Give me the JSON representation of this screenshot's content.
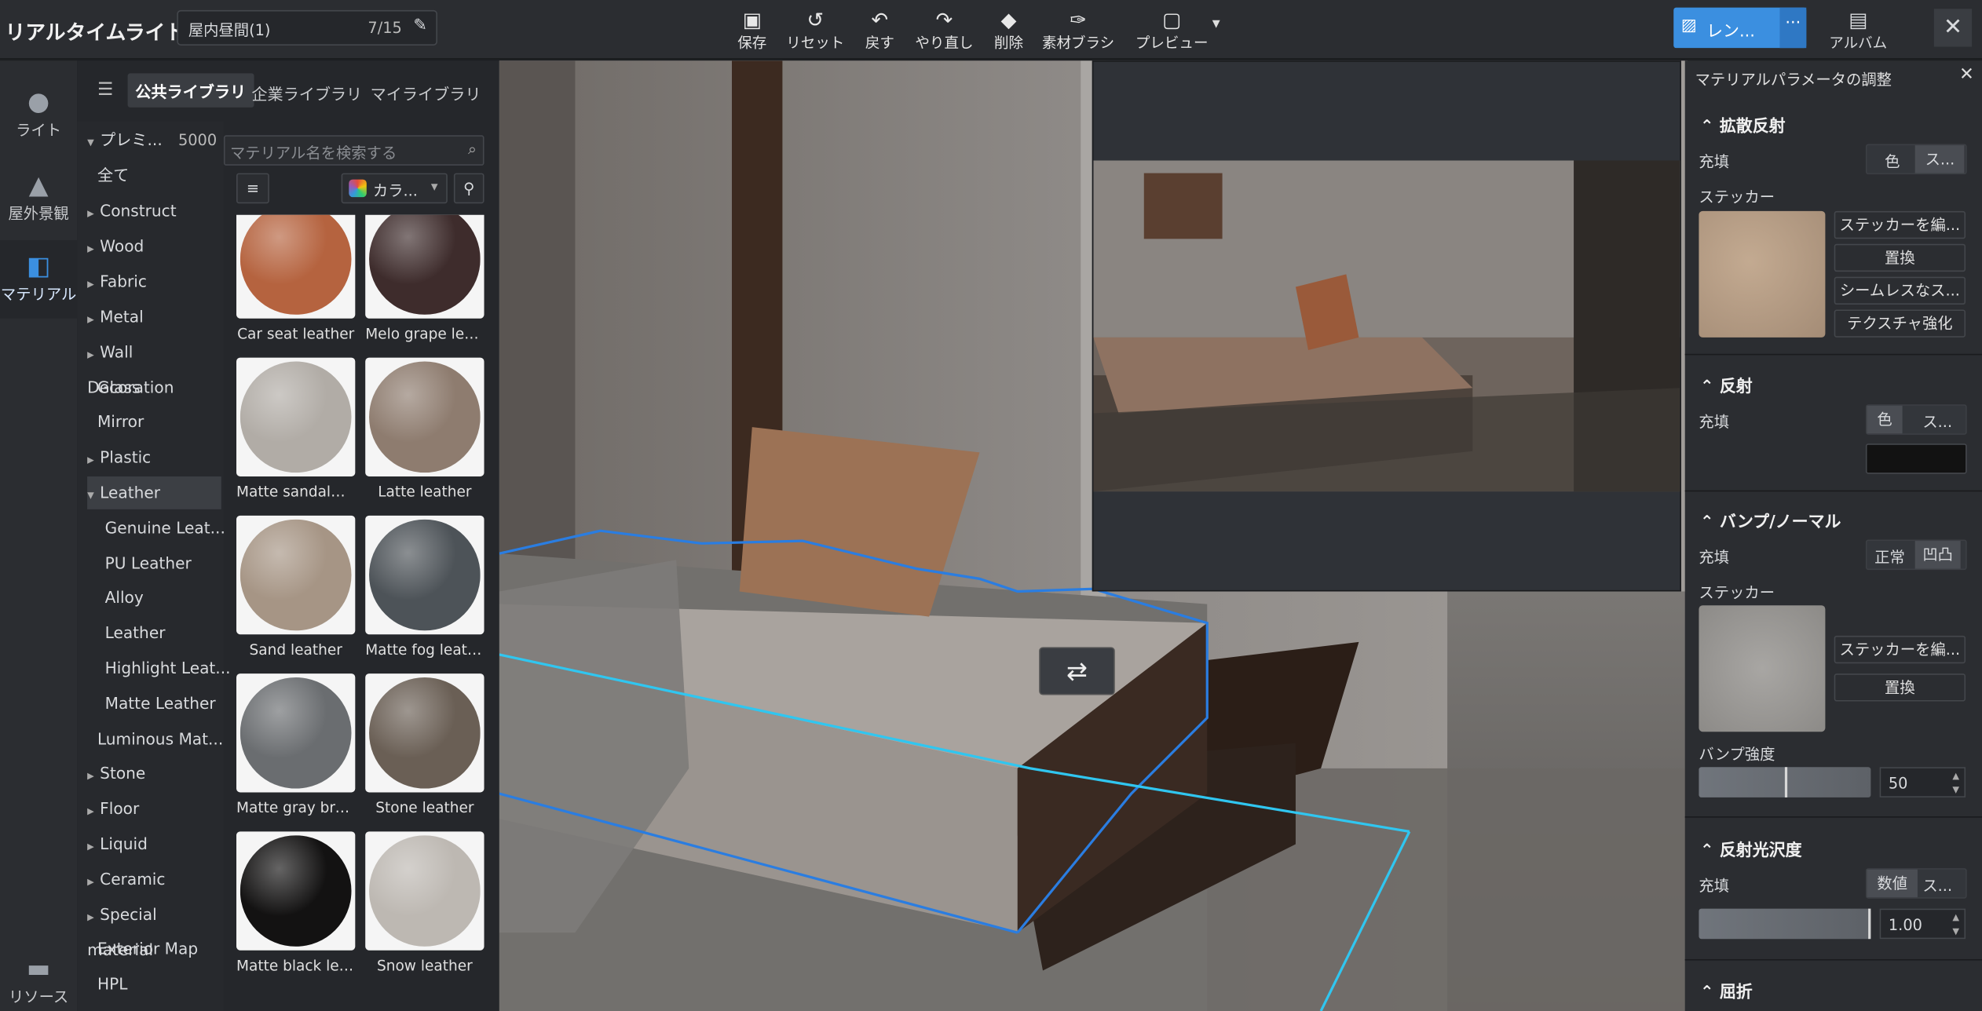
{
  "app": {
    "title": "リアルタイムライト",
    "scene_name": "屋内昼間(1)",
    "scene_count": "7/15"
  },
  "toolbar": [
    {
      "icon": "save-icon",
      "label": "保存"
    },
    {
      "icon": "reset-icon",
      "label": "リセット"
    },
    {
      "icon": "undo-icon",
      "label": "戻す"
    },
    {
      "icon": "redo-icon",
      "label": "やり直し"
    },
    {
      "icon": "eraser-icon",
      "label": "削除"
    },
    {
      "icon": "brush-icon",
      "label": "素材ブラシ"
    },
    {
      "icon": "preview-icon",
      "label": "プレビュー"
    }
  ],
  "render_button": {
    "label": "レン...",
    "more": "···"
  },
  "album": {
    "label": "アルバム"
  },
  "leftnav": [
    {
      "label": "ライト"
    },
    {
      "label": "屋外景観"
    },
    {
      "label": "マテリアル"
    },
    {
      "label": "リソース"
    }
  ],
  "library": {
    "tabs": [
      "公共ライブラリ",
      "企業ライブラリ",
      "マイライブラリ"
    ],
    "premium": {
      "label": "プレミ...",
      "count": "5000"
    },
    "categories": [
      "全て",
      "Construct",
      "Wood",
      "Fabric",
      "Metal",
      "Wall Decoration",
      "Glass",
      "Mirror",
      "Plastic",
      "Leather",
      "Genuine Leat...",
      "PU Leather",
      "Alloy",
      "Leather",
      "Highlight Leat...",
      "Matte Leather",
      "Luminous Mat...",
      "Stone",
      "Floor",
      "Liquid",
      "Ceramic",
      "Special material",
      "Exterior Map",
      "HPL"
    ],
    "search_placeholder": "マテリアル名を検索する",
    "color_filter": "カラ...",
    "materials": [
      {
        "name": "Car seat leather",
        "color": "#b5633f"
      },
      {
        "name": "Melo grape leather",
        "color": "#3e2c2c"
      },
      {
        "name": "Matte sandalwoo...",
        "color": "#b1aca6"
      },
      {
        "name": "Latte leather",
        "color": "#8e7c6f"
      },
      {
        "name": "Sand leather",
        "color": "#a69585"
      },
      {
        "name": "Matte fog leather",
        "color": "#4d5358"
      },
      {
        "name": "Matte gray brow...",
        "color": "#6a6d70"
      },
      {
        "name": "Stone leather",
        "color": "#6a5f55"
      },
      {
        "name": "Matte black leather",
        "color": "#131212"
      },
      {
        "name": "Snow leather",
        "color": "#bdb8b2"
      }
    ]
  },
  "panel": {
    "title": "マテリアルパラメータの調整",
    "diffuse": {
      "title": "拡散反射",
      "fill_label": "充填",
      "opt1": "色",
      "opt2": "ス...",
      "sticker_label": "ステッカー",
      "buttons": [
        "ステッカーを編...",
        "置換",
        "シームレスなス...",
        "テクスチャ強化"
      ]
    },
    "reflection": {
      "title": "反射",
      "fill_label": "充填",
      "opt1": "色",
      "opt2": "ス..."
    },
    "bump": {
      "title": "バンプ/ノーマル",
      "fill_label": "充填",
      "opt1": "正常",
      "opt2": "凹凸",
      "sticker_label": "ステッカー",
      "buttons": [
        "ステッカーを編...",
        "置換"
      ],
      "strength_label": "バンプ強度",
      "strength_value": "50",
      "strength": 0.5
    },
    "gloss": {
      "title": "反射光沢度",
      "fill_label": "充填",
      "opt1": "数値",
      "opt2": "ス...",
      "value": "1.00",
      "level": 1.0
    },
    "refraction": {
      "title": "屈折"
    }
  },
  "colors": {
    "accent": "#3b8fe0",
    "selection": "#2a7de1"
  }
}
